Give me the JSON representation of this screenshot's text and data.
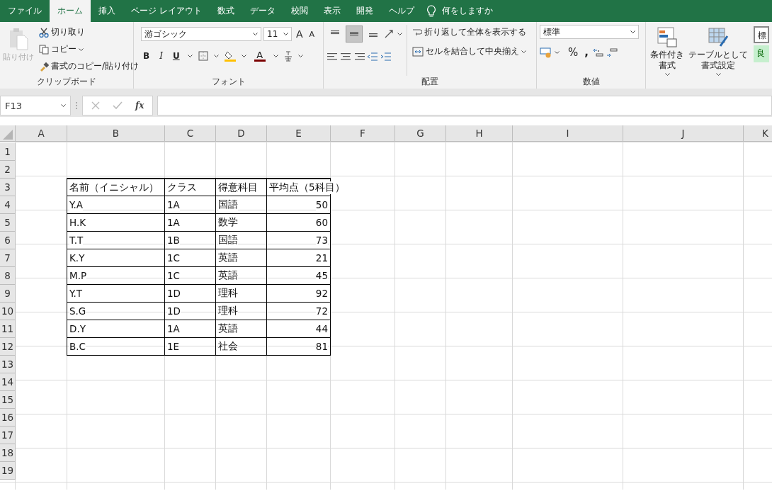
{
  "tabs": [
    {
      "label": "ファイル",
      "selected": false
    },
    {
      "label": "ホーム",
      "selected": true
    },
    {
      "label": "挿入",
      "selected": false
    },
    {
      "label": "ページ レイアウト",
      "selected": false
    },
    {
      "label": "数式",
      "selected": false
    },
    {
      "label": "データ",
      "selected": false
    },
    {
      "label": "校閲",
      "selected": false
    },
    {
      "label": "表示",
      "selected": false
    },
    {
      "label": "開発",
      "selected": false
    },
    {
      "label": "ヘルプ",
      "selected": false
    }
  ],
  "tell_me": {
    "placeholder": "何をしますか"
  },
  "ribbon": {
    "clipboard": {
      "paste": {
        "label": "貼り付け",
        "disabled": true
      },
      "cut": "切り取り",
      "copy": "コピー",
      "format_painter": "書式のコピー/貼り付け",
      "label": "クリップボード"
    },
    "font": {
      "font_name": "游ゴシック",
      "font_size": "11",
      "grow": "A",
      "shrink": "A",
      "bold": "B",
      "italic": "I",
      "underline": "U",
      "font_color": "A",
      "label": "フォント"
    },
    "alignment": {
      "vertical": [
        {
          "selected": false
        },
        {
          "selected": true
        },
        {
          "selected": false
        }
      ],
      "wrap_text": "折り返して全体を表示する",
      "merge": "セルを結合して中央揃え",
      "label": "配置"
    },
    "number": {
      "format": "標準",
      "percent": "%",
      "comma": ",",
      "label": "数値"
    },
    "styles": {
      "conditional_formatting": [
        "条件付き",
        "書式"
      ],
      "format_as_table": [
        "テーブルとして",
        "書式設定"
      ],
      "cell_styles": [
        "標",
        "良"
      ]
    }
  },
  "name_box": "F13",
  "function_label": "fx",
  "sheet": {
    "columns": [
      "A",
      "B",
      "C",
      "D",
      "E",
      "F",
      "G",
      "H",
      "I",
      "J",
      "K"
    ],
    "rows": [
      {
        "number": "1"
      },
      {
        "number": "2"
      },
      {
        "number": "3",
        "kind": "header",
        "cells": [
          {
            "text": "名前（イニシャル）",
            "kind": "text"
          },
          {
            "text": "クラス",
            "kind": "text"
          },
          {
            "text": "得意科目",
            "kind": "text"
          },
          {
            "text": "平均点（5科目）",
            "kind": "text"
          }
        ]
      },
      {
        "number": "4",
        "kind": "data",
        "cells": [
          {
            "text": "Y.A",
            "kind": "text"
          },
          {
            "text": "1A",
            "kind": "text"
          },
          {
            "text": "国語",
            "kind": "text"
          },
          {
            "text": "50",
            "kind": "number"
          }
        ]
      },
      {
        "number": "5",
        "kind": "data",
        "cells": [
          {
            "text": "H.K",
            "kind": "text"
          },
          {
            "text": "1A",
            "kind": "text"
          },
          {
            "text": "数学",
            "kind": "text"
          },
          {
            "text": "60",
            "kind": "number"
          }
        ]
      },
      {
        "number": "6",
        "kind": "data",
        "cells": [
          {
            "text": "T.T",
            "kind": "text"
          },
          {
            "text": "1B",
            "kind": "text"
          },
          {
            "text": "国語",
            "kind": "text"
          },
          {
            "text": "73",
            "kind": "number"
          }
        ]
      },
      {
        "number": "7",
        "kind": "data",
        "cells": [
          {
            "text": "K.Y",
            "kind": "text"
          },
          {
            "text": "1C",
            "kind": "text"
          },
          {
            "text": "英語",
            "kind": "text"
          },
          {
            "text": "21",
            "kind": "number"
          }
        ]
      },
      {
        "number": "8",
        "kind": "data",
        "cells": [
          {
            "text": "M.P",
            "kind": "text"
          },
          {
            "text": "1C",
            "kind": "text"
          },
          {
            "text": "英語",
            "kind": "text"
          },
          {
            "text": "45",
            "kind": "number"
          }
        ]
      },
      {
        "number": "9",
        "kind": "data",
        "cells": [
          {
            "text": "Y.T",
            "kind": "text"
          },
          {
            "text": "1D",
            "kind": "text"
          },
          {
            "text": "理科",
            "kind": "text"
          },
          {
            "text": "92",
            "kind": "number"
          }
        ]
      },
      {
        "number": "10",
        "kind": "data",
        "cells": [
          {
            "text": "S.G",
            "kind": "text"
          },
          {
            "text": "1D",
            "kind": "text"
          },
          {
            "text": "理科",
            "kind": "text"
          },
          {
            "text": "72",
            "kind": "number"
          }
        ]
      },
      {
        "number": "11",
        "kind": "data",
        "cells": [
          {
            "text": "D.Y",
            "kind": "text"
          },
          {
            "text": "1A",
            "kind": "text"
          },
          {
            "text": "英語",
            "kind": "text"
          },
          {
            "text": "44",
            "kind": "number"
          }
        ]
      },
      {
        "number": "12",
        "kind": "data",
        "cells": [
          {
            "text": "B.C",
            "kind": "text"
          },
          {
            "text": "1E",
            "kind": "text"
          },
          {
            "text": "社会",
            "kind": "text"
          },
          {
            "text": "81",
            "kind": "number"
          }
        ]
      },
      {
        "number": "13"
      },
      {
        "number": "14"
      },
      {
        "number": "15"
      },
      {
        "number": "16"
      },
      {
        "number": "17"
      },
      {
        "number": "18"
      },
      {
        "number": "19"
      }
    ]
  }
}
